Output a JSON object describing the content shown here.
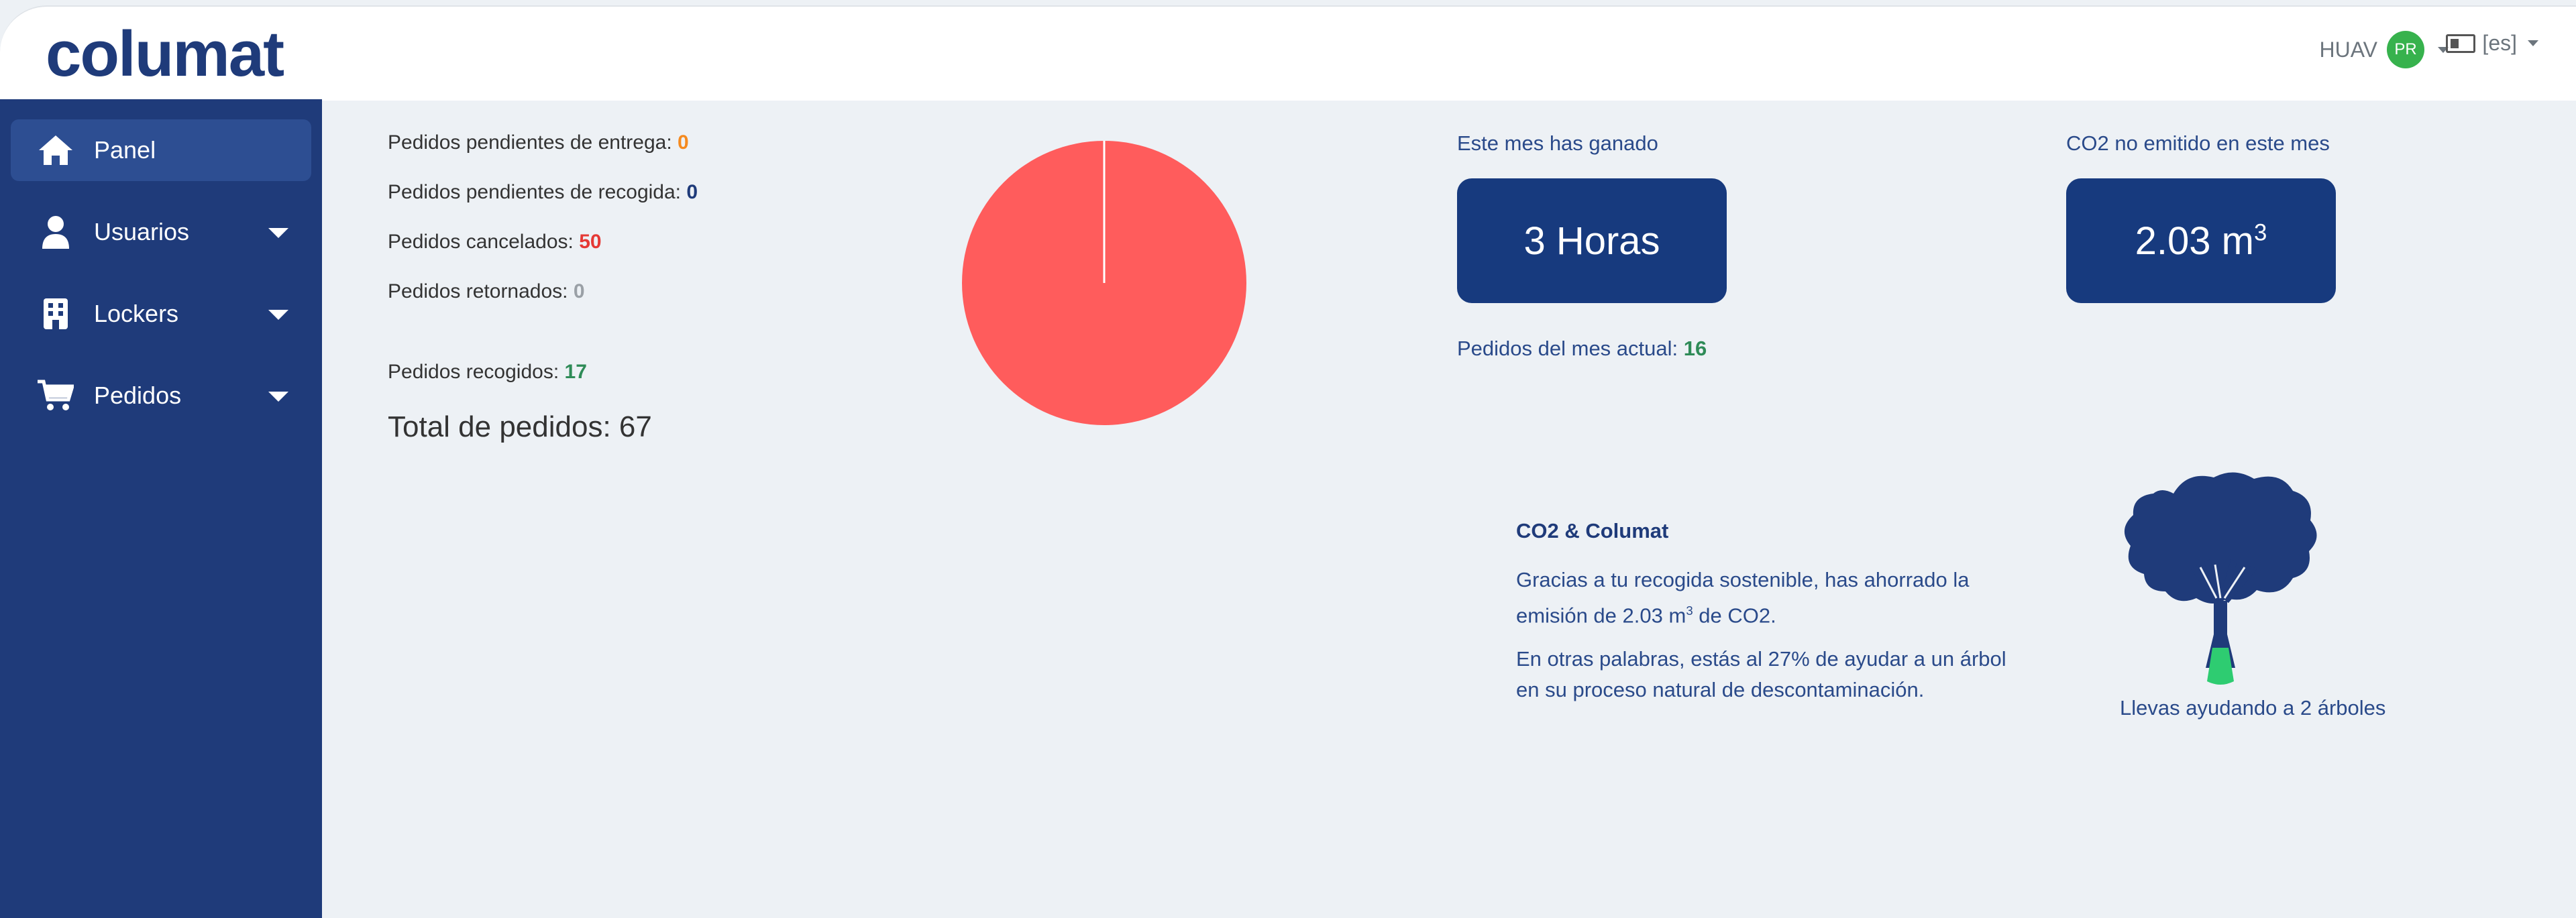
{
  "header": {
    "logo_text": "columat",
    "user_name": "HUAV",
    "user_initials": "PR",
    "language": "[es]"
  },
  "sidebar": {
    "items": [
      {
        "label": "Panel",
        "icon": "home-icon",
        "active": true
      },
      {
        "label": "Usuarios",
        "icon": "user-icon",
        "has_submenu": true
      },
      {
        "label": "Lockers",
        "icon": "building-icon",
        "has_submenu": true
      },
      {
        "label": "Pedidos",
        "icon": "cart-icon",
        "has_submenu": true
      }
    ]
  },
  "stats": {
    "pending_delivery_label": "Pedidos pendientes de entrega:",
    "pending_delivery_value": "0",
    "pending_pickup_label": "Pedidos pendientes de recogida:",
    "pending_pickup_value": "0",
    "cancelled_label": "Pedidos cancelados:",
    "cancelled_value": "50",
    "returned_label": "Pedidos retornados:",
    "returned_value": "0",
    "collected_label": "Pedidos recogidos:",
    "collected_value": "17",
    "total_label": "Total de pedidos:",
    "total_value": "67"
  },
  "chart_data": {
    "type": "pie",
    "slices": [
      {
        "value": 50,
        "color": "#ff5c5c"
      },
      {
        "value": 0,
        "color": "#ffffff"
      }
    ]
  },
  "kpi": {
    "earned_label": "Este mes has ganado",
    "earned_value": "3 Horas",
    "co2_label": "CO2 no emitido en este mes",
    "co2_value": "2.03 m",
    "co2_unit_sup": "3",
    "month_orders_label": "Pedidos del mes actual:",
    "month_orders_value": "16"
  },
  "co2_info": {
    "title": "CO2 & Columat",
    "p1_before": "Gracias a tu recogida sostenible, has ahorrado la emisión de 2.03 m",
    "p1_sup": "3",
    "p1_after": " de CO2.",
    "p2": "En otras palabras, estás al 27% de ayudar a un árbol en su proceso natural de descontaminación.",
    "tree_caption": "Llevas ayudando a 2 árboles"
  },
  "colors": {
    "brand": "#1f3b7a",
    "orange": "#f58a1f",
    "red": "#e53935",
    "green": "#2e8b57",
    "grey": "#9aa0a6",
    "tree_trunk_fill": "#2ecc71"
  }
}
